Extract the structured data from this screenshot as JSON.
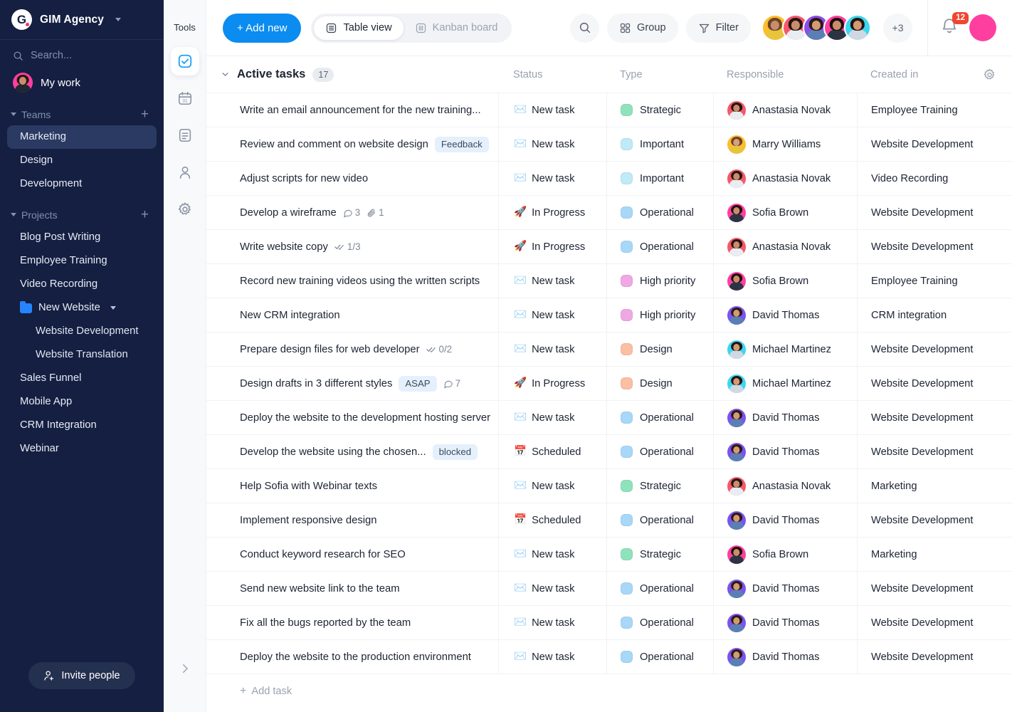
{
  "sidebar": {
    "brand": {
      "name": "GIM Agency",
      "logo_letter": "G",
      "chevron": "chevron-down-icon"
    },
    "search_placeholder": "Search...",
    "my_work": "My work",
    "teams_label": "Teams",
    "teams": [
      "Marketing",
      "Design",
      "Development"
    ],
    "active_team": "Marketing",
    "projects_label": "Projects",
    "projects": [
      {
        "label": "Blog Post Writing",
        "type": "project"
      },
      {
        "label": "Employee Training",
        "type": "project"
      },
      {
        "label": "Video Recording",
        "type": "project"
      },
      {
        "label": "New Website",
        "type": "folder"
      },
      {
        "label": "Website Development",
        "type": "sub"
      },
      {
        "label": "Website Translation",
        "type": "sub"
      },
      {
        "label": "Sales Funnel",
        "type": "project"
      },
      {
        "label": "Mobile App",
        "type": "project"
      },
      {
        "label": "CRM Integration",
        "type": "project"
      },
      {
        "label": "Webinar",
        "type": "project"
      }
    ],
    "invite_label": "Invite people",
    "accent": "#2684FE",
    "background": "#141F41"
  },
  "tools": {
    "label": "Tools",
    "items": [
      {
        "name": "tasks-checkbox-icon",
        "selected": true
      },
      {
        "name": "calendar-icon",
        "selected": false
      },
      {
        "name": "document-icon",
        "selected": false
      },
      {
        "name": "contacts-person-icon",
        "selected": false
      },
      {
        "name": "settings-gear-icon",
        "selected": false
      }
    ]
  },
  "toolbar": {
    "add_new": "+ Add new",
    "views": [
      {
        "label": "Table view",
        "icon": "table-icon",
        "active": true
      },
      {
        "label": "Kanban board",
        "icon": "kanban-icon",
        "active": false
      }
    ],
    "search_icon": "search-icon",
    "group_label": "Group",
    "filter_label": "Filter",
    "members_overflow": "+3",
    "member_avatars": [
      "#FDBD2C",
      "#F4596A",
      "#8C4DE8",
      "#FF3FA0",
      "#3ED6F0"
    ],
    "notification_count": "12",
    "accent": "#0B8CF0"
  },
  "table": {
    "group_title": "Active tasks",
    "group_count": "17",
    "columns": [
      "Status",
      "Type",
      "Responsible",
      "Created in"
    ],
    "settings_icon": "gear-icon",
    "add_task_label": "Add task",
    "type_colors": {
      "Strategic": "#8FE3BC",
      "Important": "#BFEAF7",
      "Operational": "#A8D8F8",
      "High priority": "#F0A8E4",
      "Design": "#FBBFA4"
    },
    "people_colors": {
      "Anastasia Novak": "#F4596A",
      "Marry Williams": "#FDBD2C",
      "Sofia Brown": "#FF3FA0",
      "David Thomas": "#7B53F0",
      "Michael Martinez": "#3ED6F0"
    },
    "rows": [
      {
        "task": "Write an email announcement for the new training...",
        "tag": "",
        "comments": "",
        "attachments": "",
        "checklist": "",
        "status_emoji": "✉️",
        "status": "New task",
        "type": "Strategic",
        "responsible": "Anastasia Novak",
        "created_in": "Employee Training"
      },
      {
        "task": "Review and comment on website design",
        "tag": "Feedback",
        "comments": "",
        "attachments": "",
        "checklist": "",
        "status_emoji": "✉️",
        "status": "New task",
        "type": "Important",
        "responsible": "Marry Williams",
        "created_in": "Website Development"
      },
      {
        "task": "Adjust scripts for new video",
        "tag": "",
        "comments": "",
        "attachments": "",
        "checklist": "",
        "status_emoji": "✉️",
        "status": "New task",
        "type": "Important",
        "responsible": "Anastasia Novak",
        "created_in": "Video Recording"
      },
      {
        "task": "Develop a wireframe",
        "tag": "",
        "comments": "3",
        "attachments": "1",
        "checklist": "",
        "status_emoji": "🚀",
        "status": "In Progress",
        "type": "Operational",
        "responsible": "Sofia Brown",
        "created_in": "Website Development"
      },
      {
        "task": "Write website copy",
        "tag": "",
        "comments": "",
        "attachments": "",
        "checklist": "1/3",
        "status_emoji": "🚀",
        "status": "In Progress",
        "type": "Operational",
        "responsible": "Anastasia Novak",
        "created_in": "Website Development"
      },
      {
        "task": "Record new training videos using the written scripts",
        "tag": "",
        "comments": "",
        "attachments": "",
        "checklist": "",
        "status_emoji": "✉️",
        "status": "New task",
        "type": "High priority",
        "responsible": "Sofia Brown",
        "created_in": "Employee Training"
      },
      {
        "task": "New CRM integration",
        "tag": "",
        "comments": "",
        "attachments": "",
        "checklist": "",
        "status_emoji": "✉️",
        "status": "New task",
        "type": "High priority",
        "responsible": "David Thomas",
        "created_in": "CRM integration"
      },
      {
        "task": "Prepare design files for web developer",
        "tag": "",
        "comments": "",
        "attachments": "",
        "checklist": "0/2",
        "status_emoji": "✉️",
        "status": "New task",
        "type": "Design",
        "responsible": "Michael Martinez",
        "created_in": "Website Development"
      },
      {
        "task": "Design drafts in 3 different styles",
        "tag": "ASAP",
        "comments": "7",
        "attachments": "",
        "checklist": "",
        "status_emoji": "🚀",
        "status": "In Progress",
        "type": "Design",
        "responsible": "Michael Martinez",
        "created_in": "Website Development"
      },
      {
        "task": "Deploy the website to the development hosting server",
        "tag": "",
        "comments": "",
        "attachments": "",
        "checklist": "",
        "status_emoji": "✉️",
        "status": "New task",
        "type": "Operational",
        "responsible": "David Thomas",
        "created_in": "Website Development"
      },
      {
        "task": "Develop the website using the chosen...",
        "tag": "blocked",
        "comments": "",
        "attachments": "",
        "checklist": "",
        "status_emoji": "📅",
        "status": "Scheduled",
        "type": "Operational",
        "responsible": "David Thomas",
        "created_in": "Website Development"
      },
      {
        "task": "Help Sofia with Webinar texts",
        "tag": "",
        "comments": "",
        "attachments": "",
        "checklist": "",
        "status_emoji": "✉️",
        "status": "New task",
        "type": "Strategic",
        "responsible": "Anastasia Novak",
        "created_in": "Marketing"
      },
      {
        "task": "Implement responsive design",
        "tag": "",
        "comments": "",
        "attachments": "",
        "checklist": "",
        "status_emoji": "📅",
        "status": "Scheduled",
        "type": "Operational",
        "responsible": "David Thomas",
        "created_in": "Website Development"
      },
      {
        "task": "Conduct keyword research for SEO",
        "tag": "",
        "comments": "",
        "attachments": "",
        "checklist": "",
        "status_emoji": "✉️",
        "status": "New task",
        "type": "Strategic",
        "responsible": "Sofia Brown",
        "created_in": "Marketing"
      },
      {
        "task": "Send new website link to the team",
        "tag": "",
        "comments": "",
        "attachments": "",
        "checklist": "",
        "status_emoji": "✉️",
        "status": "New task",
        "type": "Operational",
        "responsible": "David Thomas",
        "created_in": "Website Development"
      },
      {
        "task": "Fix all the bugs reported by the team",
        "tag": "",
        "comments": "",
        "attachments": "",
        "checklist": "",
        "status_emoji": "✉️",
        "status": "New task",
        "type": "Operational",
        "responsible": "David Thomas",
        "created_in": "Website Development"
      },
      {
        "task": "Deploy the website to the production environment",
        "tag": "",
        "comments": "",
        "attachments": "",
        "checklist": "",
        "status_emoji": "✉️",
        "status": "New task",
        "type": "Operational",
        "responsible": "David Thomas",
        "created_in": "Website Development"
      }
    ]
  }
}
